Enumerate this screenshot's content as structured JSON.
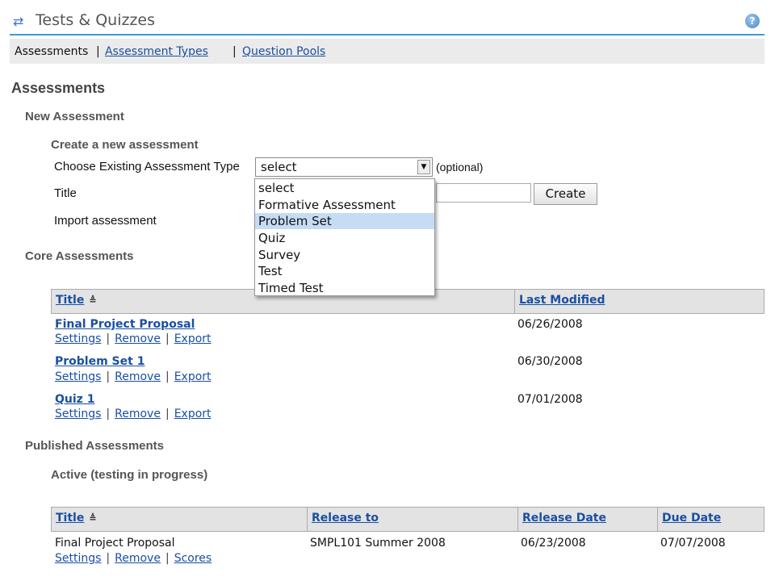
{
  "header": {
    "title": "Tests & Quizzes",
    "tool_icon": "refresh-arrows-icon",
    "help_icon": "help-icon",
    "help_glyph": "?"
  },
  "nav": {
    "current": "Assessments",
    "sep": "|",
    "types": "Assessment Types",
    "pools": "Question Pools"
  },
  "page_title": "Assessments",
  "new_section": {
    "heading": "New Assessment",
    "subheading": "Create a new assessment",
    "choose_label": "Choose Existing Assessment Type",
    "select_value": "select",
    "optional": "(optional)",
    "title_label": "Title",
    "import_label": "Import assessment",
    "create_label": "Create",
    "options": [
      "select",
      "Formative Assessment",
      "Problem Set",
      "Quiz",
      "Survey",
      "Test",
      "Timed Test"
    ],
    "highlighted_option": "Problem Set"
  },
  "core": {
    "heading": "Core Assessments",
    "col_title": "Title",
    "col_modified": "Last Modified",
    "sort_icon": "sort-ascending-icon",
    "sort_glyph": "≜",
    "rows": [
      {
        "title": "Final Project Proposal",
        "modified": "06/26/2008",
        "actions": [
          "Settings",
          "Remove",
          "Export"
        ]
      },
      {
        "title": "Problem Set 1",
        "modified": "06/30/2008",
        "actions": [
          "Settings",
          "Remove",
          "Export"
        ]
      },
      {
        "title": "Quiz 1",
        "modified": "07/01/2008",
        "actions": [
          "Settings",
          "Remove",
          "Export"
        ]
      }
    ]
  },
  "published": {
    "heading": "Published Assessments",
    "active_heading": "Active (testing in progress)",
    "col_title": "Title",
    "col_release_to": "Release to",
    "col_release_date": "Release Date",
    "col_due_date": "Due Date",
    "rows": [
      {
        "title": "Final Project Proposal",
        "release_to": "SMPL101 Summer 2008",
        "release_date": "06/23/2008",
        "due_date": "07/07/2008",
        "actions": [
          "Settings",
          "Remove",
          "Scores"
        ]
      }
    ]
  }
}
